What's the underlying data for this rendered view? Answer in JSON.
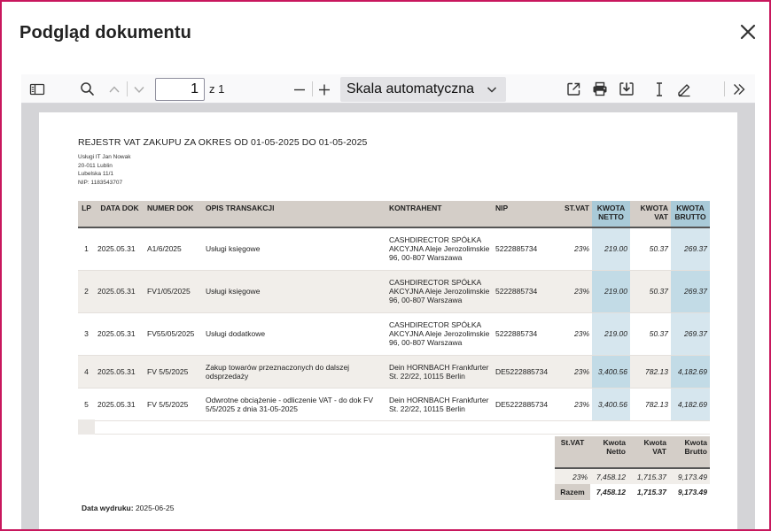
{
  "modal": {
    "title": "Podgląd dokumentu"
  },
  "toolbar": {
    "page_number": "1",
    "page_of": "z 1",
    "scale_label": "Skala automatyczna"
  },
  "document": {
    "title": "REJESTR VAT ZAKUPU ZA OKRES OD 01-05-2025 DO 01-05-2025",
    "company": {
      "name": "Usługi IT Jan Nowak",
      "city": "20-011 Lublin",
      "street": "Lubelska 11/1",
      "nip": "NIP: 1183543707"
    },
    "columns": [
      "LP",
      "DATA DOK",
      "NUMER DOK",
      "OPIS TRANSAKCJI",
      "KONTRAHENT",
      "NIP",
      "ST.VAT",
      "KWOTA NETTO",
      "KWOTA VAT",
      "KWOTA BRUTTO"
    ],
    "rows": [
      {
        "lp": "1",
        "date": "2025.05.31",
        "number": "A1/6/2025",
        "description": "Usługi księgowe",
        "contractor": "CASHDIRECTOR SPÓŁKA AKCYJNA Aleje Jerozolimskie 96, 00-807 Warszawa",
        "nip": "5222885734",
        "vat_rate": "23%",
        "net": "219.00",
        "vat": "50.37",
        "gross": "269.37"
      },
      {
        "lp": "2",
        "date": "2025.05.31",
        "number": "FV1/05/2025",
        "description": "Usługi księgowe",
        "contractor": "CASHDIRECTOR SPÓŁKA AKCYJNA Aleje Jerozolimskie 96, 00-807 Warszawa",
        "nip": "5222885734",
        "vat_rate": "23%",
        "net": "219.00",
        "vat": "50.37",
        "gross": "269.37"
      },
      {
        "lp": "3",
        "date": "2025.05.31",
        "number": "FV55/05/2025",
        "description": "Usługi dodatkowe",
        "contractor": "CASHDIRECTOR SPÓŁKA AKCYJNA Aleje Jerozolimskie 96, 00-807 Warszawa",
        "nip": "5222885734",
        "vat_rate": "23%",
        "net": "219.00",
        "vat": "50.37",
        "gross": "269.37"
      },
      {
        "lp": "4",
        "date": "2025.05.31",
        "number": "FV 5/5/2025",
        "description": "Zakup towarów przeznaczonych do dalszej odsprzedaży",
        "contractor": "Dein HORNBACH Frankfurter St. 22/22, 10115 Berlin",
        "nip": "DE5222885734",
        "vat_rate": "23%",
        "net": "3,400.56",
        "vat": "782.13",
        "gross": "4,182.69"
      },
      {
        "lp": "5",
        "date": "2025.05.31",
        "number": "FV 5/5/2025",
        "description": "Odwrotne obciążenie - odliczenie VAT - do dok FV 5/5/2025 z dnia 31-05-2025",
        "contractor": "Dein HORNBACH Frankfurter St. 22/22, 10115 Berlin",
        "nip": "DE5222885734",
        "vat_rate": "23%",
        "net": "3,400.56",
        "vat": "782.13",
        "gross": "4,182.69"
      }
    ],
    "summary": {
      "columns": [
        "St.VAT",
        "Kwota Netto",
        "Kwota VAT",
        "Kwota Brutto"
      ],
      "row": {
        "rate": "23%",
        "net": "7,458.12",
        "vat": "1,715.37",
        "gross": "9,173.49"
      },
      "total": {
        "label": "Razem",
        "net": "7,458.12",
        "vat": "1,715.37",
        "gross": "9,173.49"
      }
    },
    "print_date_label": "Data wydruku:",
    "print_date": "2025-06-25"
  },
  "icons": [
    "close-icon",
    "sidebar-toggle-icon",
    "search-icon",
    "chevron-up-icon",
    "chevron-down-icon",
    "minus-icon",
    "plus-icon",
    "open-external-icon",
    "print-icon",
    "download-icon",
    "text-cursor-icon",
    "pen-icon",
    "double-chevron-right-icon"
  ]
}
